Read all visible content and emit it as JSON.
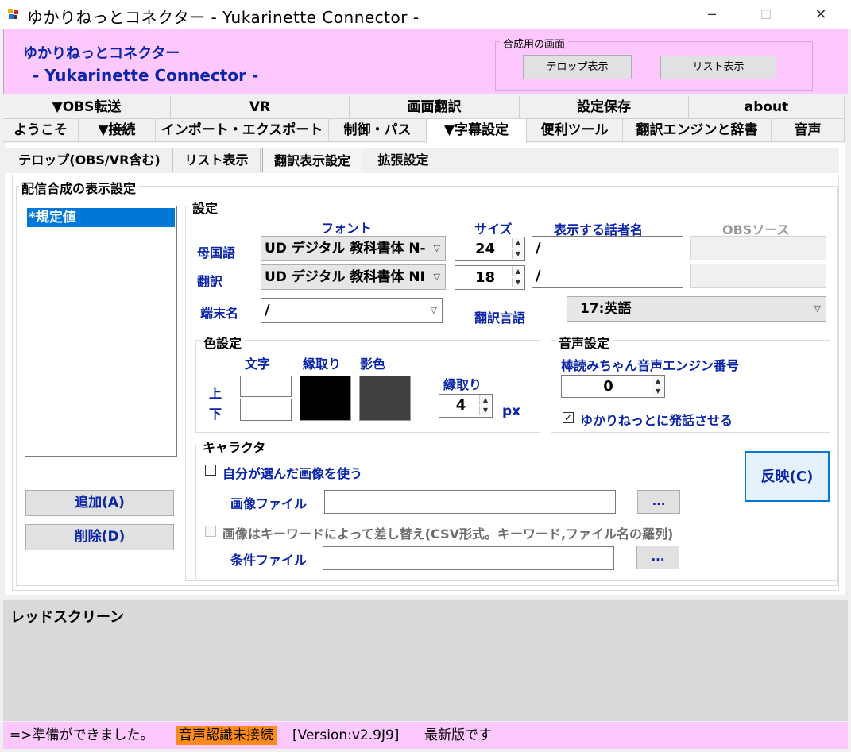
{
  "window": {
    "title": "ゆかりねっとコネクター  - Yukarinette Connector -",
    "min_glyph": "─",
    "max_glyph": "☐",
    "close_glyph": "✕"
  },
  "header": {
    "title_line1": "ゆかりねっとコネクター",
    "title_line2": "- Yukarinette Connector -",
    "compose_group_label": "合成用の画面",
    "telop_button": "テロップ表示",
    "list_button": "リスト表示"
  },
  "tabs_row1": [
    "▼OBS転送",
    "VR",
    "画面翻訳",
    "設定保存",
    "about"
  ],
  "tabs_row2": [
    "ようこそ",
    "▼接続",
    "インポート・エクスポート",
    "制御・パス",
    "▼字幕設定",
    "便利ツール",
    "翻訳エンジンと辞書",
    "音声"
  ],
  "subtabs": [
    "テロップ(OBS/VR含む)",
    "リスト表示",
    "翻訳表示設定",
    "拡張設定"
  ],
  "broadcast_group": {
    "label": "配信合成の表示設定",
    "profiles": [
      "*規定値"
    ],
    "add_button": "追加(A)",
    "delete_button": "削除(D)"
  },
  "settings": {
    "label": "設定",
    "col_font": "フォント",
    "col_size": "サイズ",
    "col_speaker": "表示する話者名",
    "col_obs": "OBSソース",
    "native_label": "母国語",
    "native_font": "UD デジタル 教科書体 N-",
    "native_size": "24",
    "native_speaker": "/",
    "trans_label": "翻訳",
    "trans_font": "UD デジタル 教科書体 NI",
    "trans_size": "18",
    "trans_speaker": "/",
    "terminal_label": "端末名",
    "terminal_value": "/",
    "lang_label": "翻訳言語",
    "lang_value": "17:英語"
  },
  "color": {
    "label": "色設定",
    "text_label": "文字",
    "outline_label": "縁取り",
    "shadow_label": "影色",
    "upper_label": "上",
    "lower_label": "下",
    "outline_width_label": "縁取り",
    "outline_width_value": "4",
    "px_label": "px",
    "text_upper_color": "#ffffff",
    "text_lower_color": "#ffffff",
    "outline_color": "#000000",
    "shadow_color": "#404040"
  },
  "voice": {
    "label": "音声設定",
    "engine_label": "棒読みちゃん音声エンジン番号",
    "engine_value": "0",
    "speak_label": "ゆかりねっとに発話させる",
    "speak_checked": true
  },
  "character": {
    "label": "キャラクタ",
    "use_image_label": "自分が選んだ画像を使う",
    "image_file_label": "画像ファイル",
    "image_file_value": "",
    "browse1": "...",
    "keyword_label": "画像はキーワードによって差し替え(CSV形式。キーワード,ファイル名の羅列)",
    "condition_file_label": "条件ファイル",
    "condition_file_value": "",
    "browse2": "..."
  },
  "apply_button": "反映(C)",
  "redscreen": {
    "label": "レッドスクリーン"
  },
  "statusbar": {
    "ready": "=>準備ができました。",
    "voice_status": "音声認識未接続",
    "version": "[Version:v2.9J9]",
    "latest": "最新版です",
    "voice_status_bg": "#ff8c1a"
  }
}
